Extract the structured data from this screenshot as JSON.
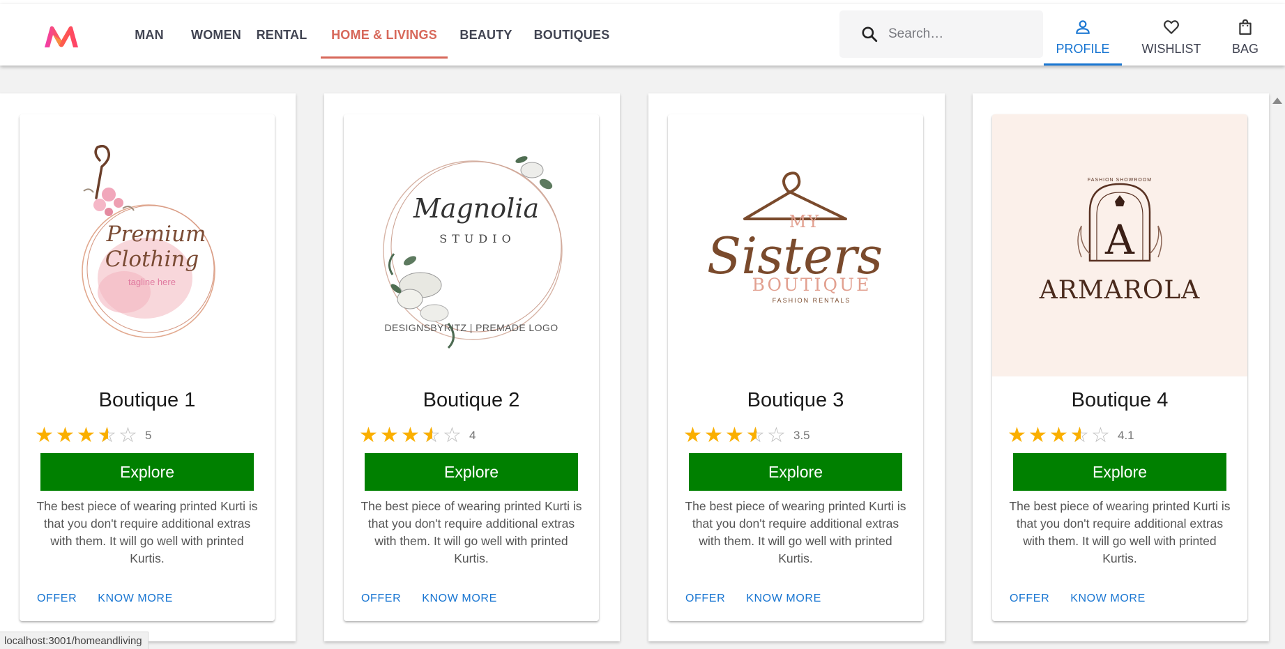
{
  "header": {
    "nav": [
      {
        "label": "MAN",
        "active": false
      },
      {
        "label": "WOMEN",
        "active": false
      },
      {
        "label": "RENTAL",
        "active": false
      },
      {
        "label": "HOME & LIVINGS",
        "active": true
      },
      {
        "label": "BEAUTY",
        "active": false
      },
      {
        "label": "BOUTIQUES",
        "active": false
      }
    ],
    "search": {
      "placeholder": "Search…"
    },
    "actions": {
      "profile": "PROFILE",
      "wishlist": "WISHLIST",
      "bag": "BAG"
    }
  },
  "cards": [
    {
      "title": "Boutique 1",
      "rating": 3.5,
      "rating_label": "5",
      "explore": "Explore",
      "description": "The best piece of wearing printed Kurti is that you don't require additional extras with them. It will go well with printed Kurtis.",
      "offer": "OFFER",
      "know_more": "KNOW MORE",
      "logo": {
        "line1": "Premium",
        "line2": "Clothing",
        "tagline": "tagline here"
      }
    },
    {
      "title": "Boutique 2",
      "rating": 3.5,
      "rating_label": "4",
      "explore": "Explore",
      "description": "The best piece of wearing printed Kurti is that you don't require additional extras with them. It will go well with printed Kurtis.",
      "offer": "OFFER",
      "know_more": "KNOW MORE",
      "logo": {
        "line1": "Magnolia",
        "line2": "STUDIO",
        "footer": "DESIGNSBYRITZ | PREMADE LOGO"
      }
    },
    {
      "title": "Boutique 3",
      "rating": 3.5,
      "rating_label": "3.5",
      "explore": "Explore",
      "description": "The best piece of wearing printed Kurti is that you don't require additional extras with them. It will go well with printed Kurtis.",
      "offer": "OFFER",
      "know_more": "KNOW MORE",
      "logo": {
        "line1": "MY",
        "line2": "Sisters",
        "line3": "BOUTIQUE",
        "tagline": "FASHION RENTALS"
      }
    },
    {
      "title": "Boutique 4",
      "rating": 3.5,
      "rating_label": "4.1",
      "explore": "Explore",
      "description": "The best piece of wearing printed Kurti is that you don't require additional extras with them. It will go well with printed Kurtis.",
      "offer": "OFFER",
      "know_more": "KNOW MORE",
      "logo": {
        "arc": "FASHION SHOWROOM",
        "letter": "A",
        "name": "ARMAROLA"
      }
    }
  ],
  "status_bar": {
    "url": "localhost:3001/homeandliving"
  },
  "colors": {
    "active_nav": "#d7685a",
    "explore_bg": "#008000",
    "accent_blue": "#1976d2",
    "star": "#faaf00"
  }
}
